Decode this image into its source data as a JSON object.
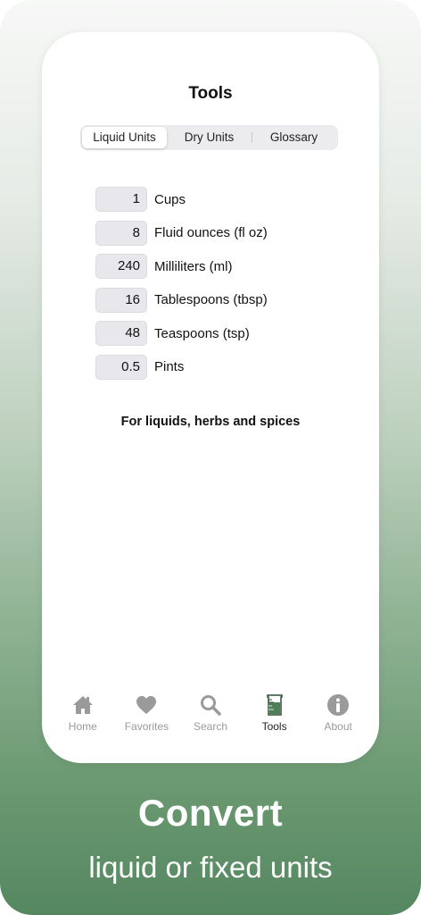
{
  "screen": {
    "title": "Tools"
  },
  "segments": [
    {
      "label": "Liquid Units",
      "active": true
    },
    {
      "label": "Dry Units",
      "active": false
    },
    {
      "label": "Glossary",
      "active": false
    }
  ],
  "units": [
    {
      "value": "1",
      "name": "Cups"
    },
    {
      "value": "8",
      "name": "Fluid ounces (fl oz)"
    },
    {
      "value": "240",
      "name": "Milliliters (ml)"
    },
    {
      "value": "16",
      "name": "Tablespoons (tbsp)"
    },
    {
      "value": "48",
      "name": "Teaspoons (tsp)"
    },
    {
      "value": "0.5",
      "name": "Pints"
    }
  ],
  "note": "For liquids, herbs and spices",
  "tabbar": {
    "items": [
      {
        "label": "Home",
        "icon": "home-icon",
        "active": false
      },
      {
        "label": "Favorites",
        "icon": "heart-icon",
        "active": false
      },
      {
        "label": "Search",
        "icon": "search-icon",
        "active": false
      },
      {
        "label": "Tools",
        "icon": "beaker-icon",
        "active": true
      },
      {
        "label": "About",
        "icon": "info-icon",
        "active": false
      }
    ]
  },
  "promo": {
    "headline": "Convert",
    "subline": "liquid or fixed units"
  },
  "colors": {
    "accent_green": "#4f7f58",
    "inactive_gray": "#9a9a9a"
  }
}
